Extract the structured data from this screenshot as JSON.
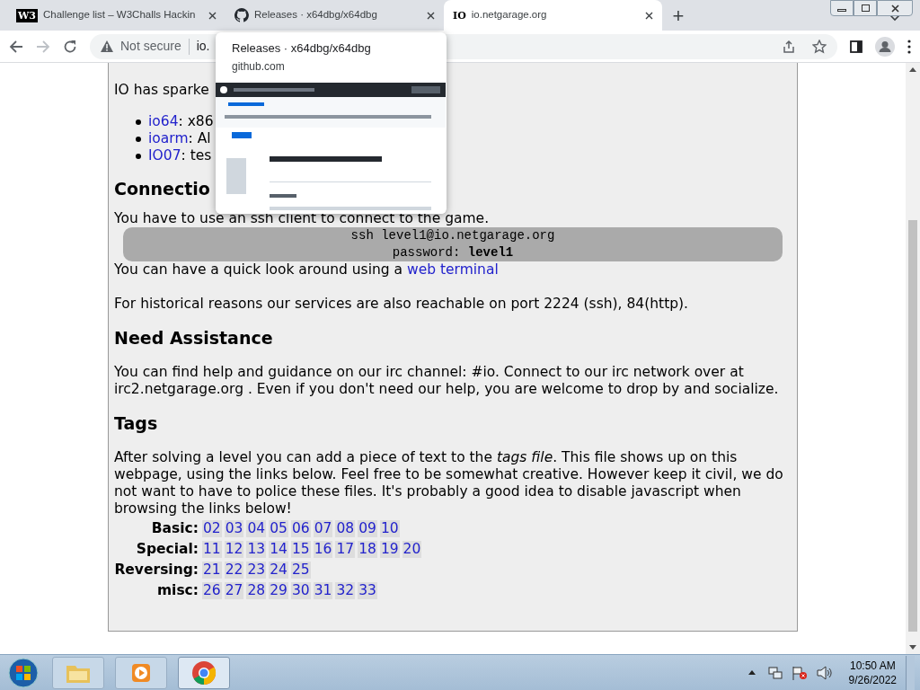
{
  "tabs": [
    {
      "favicon": "W3",
      "kind": "text",
      "title": "Challenge list – W3Challs Hackin",
      "selected": false
    },
    {
      "kind": "github",
      "title": "Releases · x64dbg/x64dbg",
      "selected": false
    },
    {
      "favicon": "IO",
      "kind": "text",
      "title": "io.netgarage.org",
      "selected": true
    }
  ],
  "new_tab": "+",
  "address": {
    "warning": "Not secure",
    "url": "io."
  },
  "hover_card": {
    "title": "Releases · x64dbg/x64dbg",
    "domain": "github.com"
  },
  "page": {
    "intro": "IO has sparke",
    "list": [
      {
        "link": "io64",
        "text": ": x86"
      },
      {
        "link": "ioarm",
        "text": ": Al"
      },
      {
        "link": "IO07",
        "text": ": tes"
      }
    ],
    "connection": {
      "heading": "Connectio",
      "para": "You have to use an ssh client to connect to the game.",
      "code": [
        "ssh level1@io.netgarage.org",
        "password: **level1**"
      ],
      "terminal": {
        "before": "You can have a quick look around using a ",
        "link": "web terminal"
      },
      "historical": "For historical reasons our services are also reachable on port 2224 (ssh), 84(http)."
    },
    "assistance": {
      "heading": "Need Assistance",
      "para": "You can find help and guidance on our irc channel: #io. Connect to our irc network over at irc2.netgarage.org . Even if you don't need our help, you are welcome to drop by and socialize."
    },
    "tags": {
      "heading": "Tags",
      "para": "After solving a level you can add a piece of text to the *tags file*. This file shows up on this webpage, using the links below. Feel free to be somewhat creative. However keep it civil, we do not want to have to police these files. It's probably a good idea to disable javascript when browsing the links below!",
      "rows": [
        {
          "label": "Basic:",
          "links": [
            "02",
            "03",
            "04",
            "05",
            "06",
            "07",
            "08",
            "09",
            "10"
          ]
        },
        {
          "label": "Special:",
          "links": [
            "11",
            "12",
            "13",
            "14",
            "15",
            "16",
            "17",
            "18",
            "19",
            "20"
          ]
        },
        {
          "label": "Reversing:",
          "links": [
            "21",
            "22",
            "23",
            "24",
            "25"
          ]
        },
        {
          "label": "misc:",
          "links": [
            "26",
            "27",
            "28",
            "29",
            "30",
            "31",
            "32",
            "33"
          ]
        }
      ]
    }
  },
  "taskbar": {
    "apps": [
      {
        "kind": "folder",
        "selected": false
      },
      {
        "kind": "media",
        "selected": false
      },
      {
        "kind": "chrome",
        "selected": true
      }
    ],
    "time": "10:50 AM",
    "date": "9/26/2022"
  }
}
